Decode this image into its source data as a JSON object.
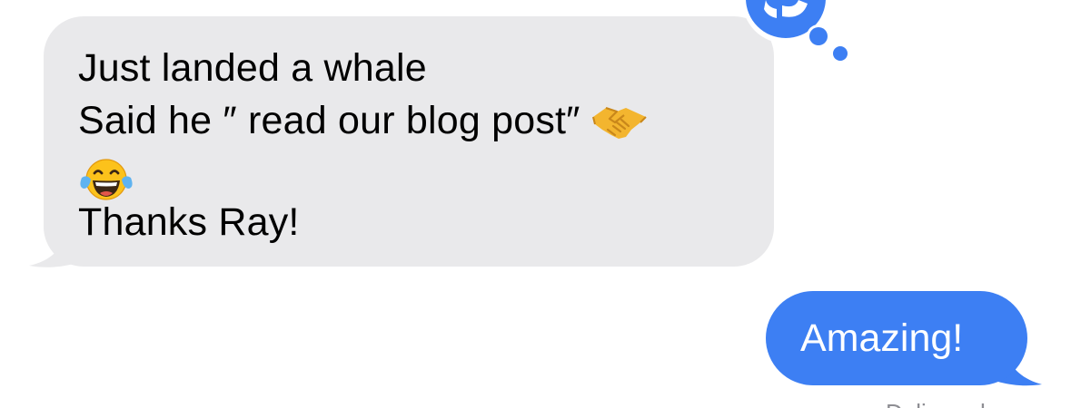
{
  "conversation": {
    "incoming": {
      "line1": "Just landed a whale",
      "line2": "Said he ″ read our blog post″",
      "line2_emoji": "handshake-emoji",
      "line3_emoji": "tears-of-joy-emoji",
      "line4": "Thanks Ray!",
      "tapback": "emphasis-reaction-icon"
    },
    "outgoing": {
      "text": "Amazing!"
    },
    "status": "Delivered"
  },
  "colors": {
    "incoming_bubble": "#e9e9eb",
    "outgoing_bubble": "#3d7ff3",
    "tapback": "#3d7ff3",
    "text": "#000000",
    "outgoing_text": "#ffffff"
  }
}
